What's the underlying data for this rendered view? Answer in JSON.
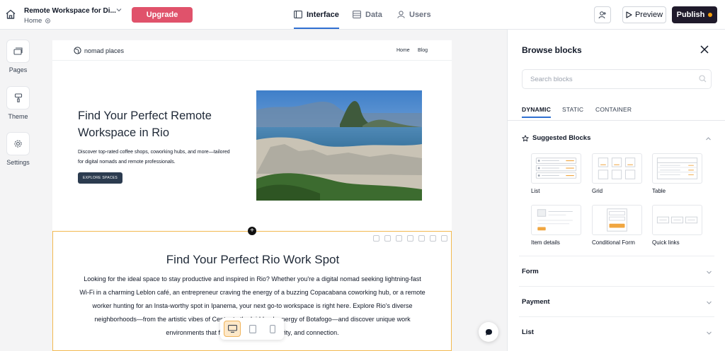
{
  "topbar": {
    "project_title": "Remote Workspace for Di...",
    "breadcrumb": "Home",
    "upgrade_label": "Upgrade",
    "tabs": [
      {
        "label": "Interface",
        "icon": "interface-icon",
        "active": true
      },
      {
        "label": "Data",
        "icon": "table-icon",
        "active": false
      },
      {
        "label": "Users",
        "icon": "user-icon",
        "active": false
      }
    ],
    "preview_label": "Preview",
    "publish_label": "Publish"
  },
  "left_rail": {
    "items": [
      {
        "label": "Pages",
        "icon": "pages-icon"
      },
      {
        "label": "Theme",
        "icon": "paint-roller-icon"
      },
      {
        "label": "Settings",
        "icon": "gear-icon"
      }
    ]
  },
  "site": {
    "logo_text": "nomad places",
    "nav": [
      "Home",
      "Blog"
    ],
    "hero_title": "Find Your Perfect Remote Workspace in Rio",
    "hero_description": "Discover top-rated coffee shops, coworking hubs, and more—tailored for digital nomads and remote professionals.",
    "hero_button": "EXPLORE SPACES",
    "section_title": "Find Your Perfect Rio Work Spot",
    "section_body": "Looking for the ideal space to stay productive and inspired in Rio? Whether you're a digital nomad seeking lightning-fast Wi-Fi in a charming Leblon café, an entrepreneur craving the energy of a buzzing Copacabana coworking hub, or a remote worker hunting for an Insta-worthy spot in Ipanema, your next go-to workspace is right here. Explore Rio's diverse neighborhoods—from the artistic vibes of Centro to the laid-back energy of Botafogo—and discover unique work environments that fuel productivity, creativity, and connection."
  },
  "panel": {
    "title": "Browse blocks",
    "search_placeholder": "Search blocks",
    "tabs": [
      {
        "label": "DYNAMIC",
        "active": true
      },
      {
        "label": "STATIC",
        "active": false
      },
      {
        "label": "CONTAINER",
        "active": false
      }
    ],
    "suggested_title": "Suggested Blocks",
    "blocks": [
      "List",
      "Grid",
      "Table",
      "Item details",
      "Conditional Form",
      "Quick links"
    ],
    "sections": [
      "Form",
      "Payment",
      "List"
    ]
  },
  "colors": {
    "upgrade": "#e0526b",
    "publish": "#1f1a2b",
    "accent_blue": "#2f6fd1",
    "selection_orange": "#f2b950"
  }
}
